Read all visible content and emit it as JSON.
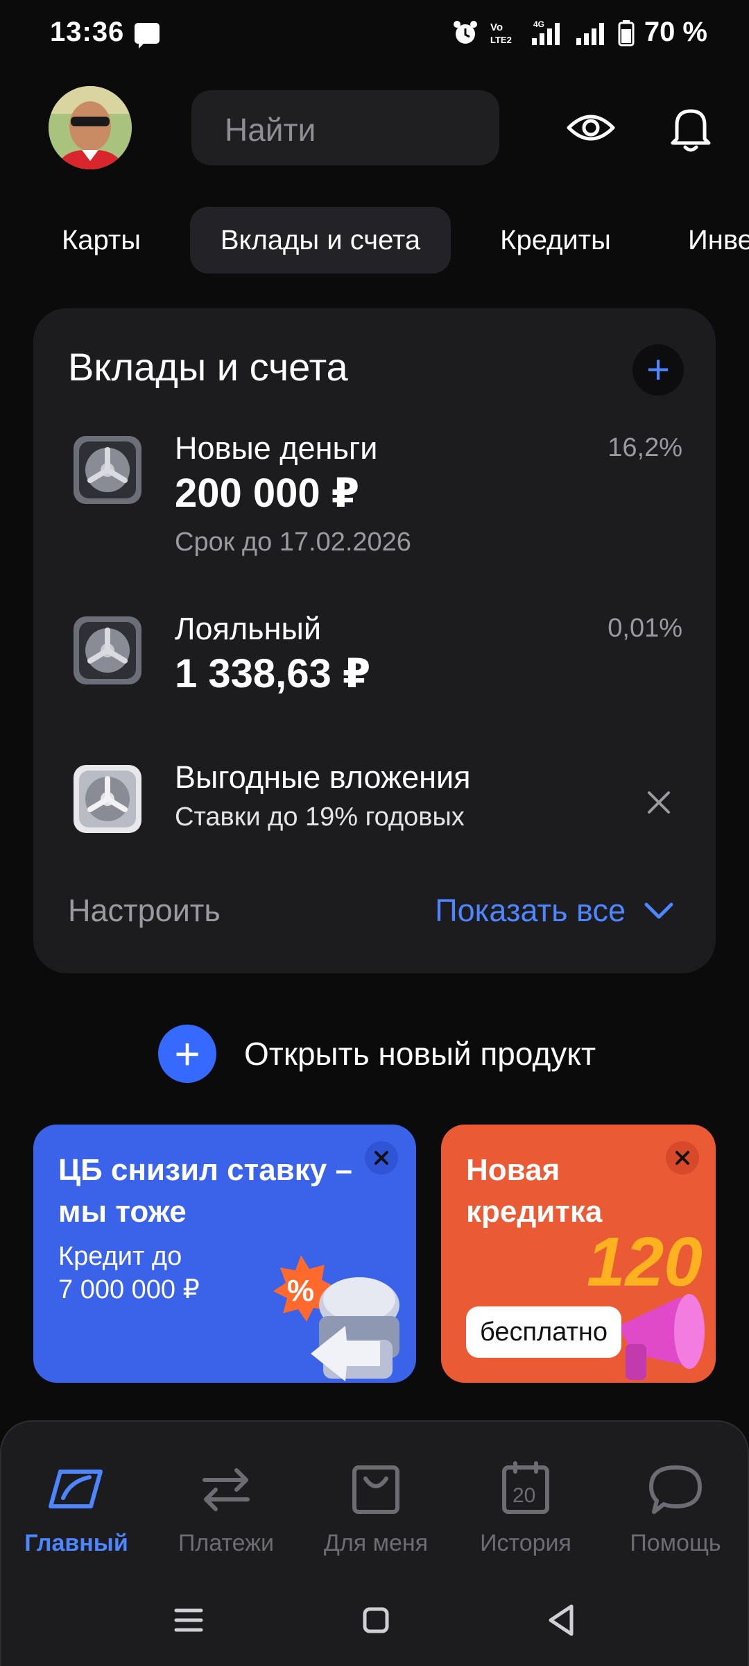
{
  "status_bar": {
    "time": "13:36",
    "battery_percent": "70 %",
    "network": "4G",
    "volte": "Vo LTE2"
  },
  "header": {
    "search_placeholder": "Найти"
  },
  "tabs": [
    {
      "label": "Карты",
      "active": false
    },
    {
      "label": "Вклады и счета",
      "active": true
    },
    {
      "label": "Кредиты",
      "active": false
    },
    {
      "label": "Инве",
      "active": false
    }
  ],
  "deposits_card": {
    "title": "Вклады и счета",
    "items": [
      {
        "name": "Новые деньги",
        "amount": "200 000 ₽",
        "subtitle": "Срок до 17.02.2026",
        "rate": "16,2%"
      },
      {
        "name": "Лояльный",
        "amount": "1 338,63 ₽",
        "rate": "0,01%"
      },
      {
        "name": "Выгодные вложения",
        "subtitle": "Ставки до 19% годовых"
      }
    ],
    "settings_label": "Настроить",
    "show_all_label": "Показать все"
  },
  "open_product_label": "Открыть новый продукт",
  "promos": [
    {
      "title": "ЦБ снизил ставку –\nмы тоже",
      "subtitle": "Кредит до\n7 000 000 ₽"
    },
    {
      "title": "Новая\nкредитка",
      "badge": "бесплатно",
      "art_number": "120"
    }
  ],
  "bottom_nav": [
    {
      "label": "Главный",
      "icon": "home-icon",
      "active": true
    },
    {
      "label": "Платежи",
      "icon": "transfer-icon",
      "active": false
    },
    {
      "label": "Для меня",
      "icon": "bag-icon",
      "active": false
    },
    {
      "label": "История",
      "icon": "calendar-icon",
      "active": false,
      "icon_text": "20"
    },
    {
      "label": "Помощь",
      "icon": "chat-icon",
      "active": false
    }
  ],
  "colors": {
    "background": "#0b0b0c",
    "card": "#1c1c1f",
    "accent": "#4e86ff",
    "promo_blue": "#3a63ea",
    "promo_orange": "#ea5a34"
  }
}
